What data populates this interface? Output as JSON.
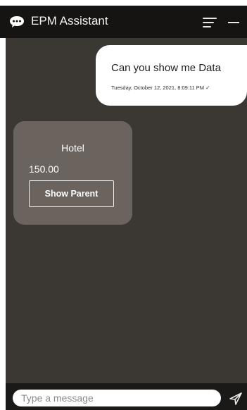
{
  "header": {
    "title": "EPM Assistant",
    "icons": [
      "chat-bubble-icon",
      "menu-icon",
      "minimize-icon"
    ]
  },
  "conversation": {
    "user_message": {
      "text": "Can you show me Data",
      "timestamp": "Tuesday, October 12, 2021, 8:09:11 PM ✓"
    },
    "bot_card": {
      "title": "Hotel",
      "value": "150.00",
      "button_label": "Show Parent"
    }
  },
  "footer": {
    "input_placeholder": "Type a message",
    "send_icon": "send-icon"
  },
  "colors": {
    "header_bg": "#151413",
    "conversation_bg": "#3b3834",
    "card_bg": "#6b645e",
    "user_bubble_bg": "#ffffff"
  }
}
